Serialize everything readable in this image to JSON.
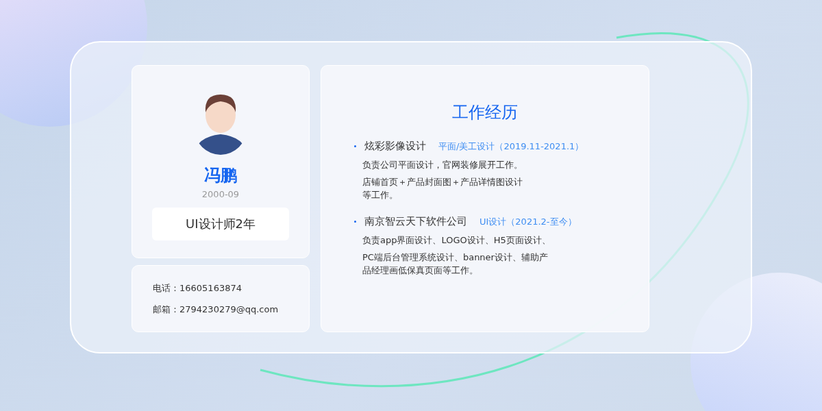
{
  "profile": {
    "name": "冯鹏",
    "birth": "2000-09",
    "title": "UI设计师2年"
  },
  "contact": [
    {
      "label": "电话：",
      "value": "16605163874"
    },
    {
      "label": "邮箱：",
      "value": "2794230279@qq.com"
    }
  ],
  "experience": {
    "heading": "工作经历",
    "items": [
      {
        "company": "炫彩影像设计",
        "role": "平面/美工设计（2019.11-2021.1）",
        "paragraphs": [
          [
            "负责公司平面设计，官网装修展开工作。"
          ],
          [
            "店铺首页＋产品封面图＋产品详情图设计",
            "等工作。"
          ]
        ]
      },
      {
        "company": "南京智云天下软件公司",
        "role": "UI设计（2021.2-至今）",
        "paragraphs": [
          [
            "负责app界面设计、LOGO设计、H5页面设计、"
          ],
          [
            "PC端后台管理系统设计、banner设计、辅助产",
            "品经理画低保真页面等工作。"
          ]
        ]
      }
    ]
  }
}
